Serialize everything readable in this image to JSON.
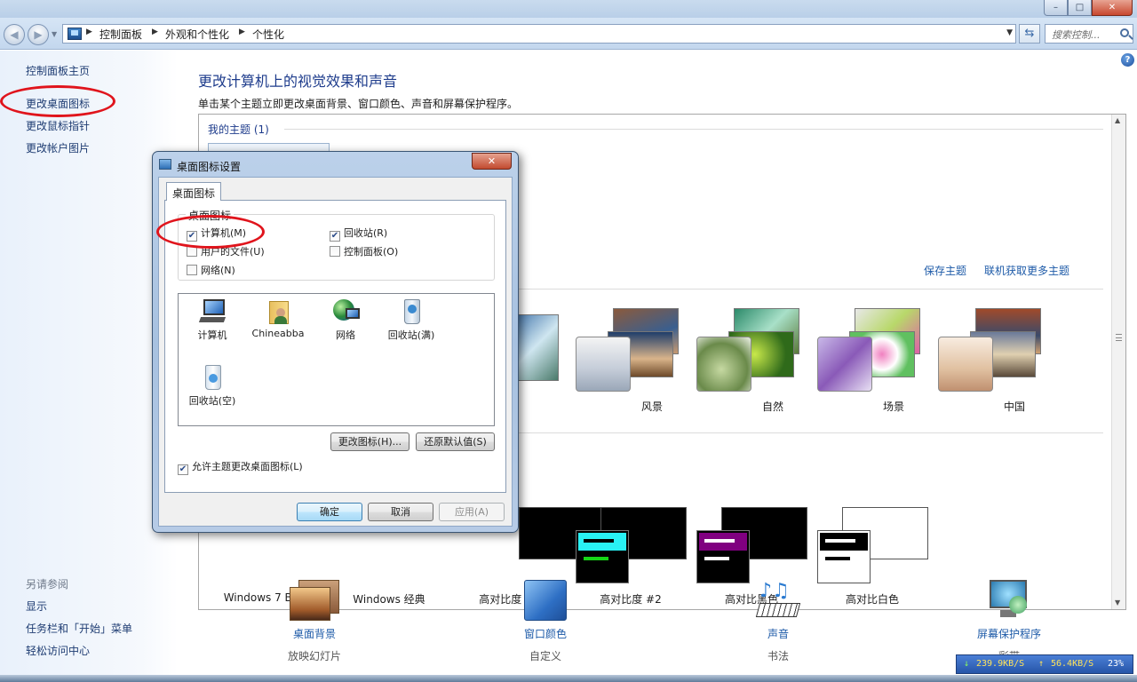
{
  "window": {
    "min": "–",
    "max": "□",
    "close": "✕"
  },
  "address": {
    "breadcrumbs": [
      "控制面板",
      "外观和个性化",
      "个性化"
    ],
    "search_placeholder": "搜索控制..."
  },
  "sidebar": {
    "home": "控制面板主页",
    "links": [
      "更改桌面图标",
      "更改鼠标指针",
      "更改帐户图片"
    ],
    "see_also_label": "另请参阅",
    "see_also": [
      "显示",
      "任务栏和「开始」菜单",
      "轻松访问中心"
    ]
  },
  "main": {
    "title": "更改计算机上的视觉效果和声音",
    "subtitle": "单击某个主题立即更改桌面背景、窗口颜色、声音和屏幕保护程序。",
    "my_themes": "我的主题 (1)",
    "save_theme": "保存主题",
    "get_more_themes": "联机获取更多主题",
    "aero_themes": [
      "风景",
      "自然",
      "场景",
      "中国"
    ],
    "basic_themes": [
      "Windows 7 Basic",
      "Windows 经典",
      "高对比度 #1",
      "高对比度 #2",
      "高对比黑色",
      "高对比白色"
    ]
  },
  "bottom": [
    {
      "label": "桌面背景",
      "sub": "放映幻灯片"
    },
    {
      "label": "窗口颜色",
      "sub": "自定义"
    },
    {
      "label": "声音",
      "sub": "书法"
    },
    {
      "label": "屏幕保护程序",
      "sub": "彩带"
    }
  ],
  "dialog": {
    "title": "桌面图标设置",
    "tab": "桌面图标",
    "group_legend": "桌面图标",
    "checkboxes": {
      "computer": {
        "label": "计算机(M)",
        "checked": true
      },
      "recycle": {
        "label": "回收站(R)",
        "checked": true
      },
      "user_files": {
        "label": "用户的文件(U)",
        "checked": false
      },
      "control_panel": {
        "label": "控制面板(O)",
        "checked": false
      },
      "network": {
        "label": "网络(N)",
        "checked": false
      }
    },
    "icons": [
      "计算机",
      "Chineabba",
      "网络",
      "回收站(满)",
      "回收站(空)"
    ],
    "change_icon": "更改图标(H)...",
    "restore_default": "还原默认值(S)",
    "allow_themes": {
      "label": "允许主题更改桌面图标(L)",
      "checked": true
    },
    "ok": "确定",
    "cancel": "取消",
    "apply": "应用(A)"
  },
  "netmeter": {
    "down": "239.9KB/S",
    "up": "56.4KB/S",
    "cpu": "23%"
  },
  "colors": {
    "link": "#1e5ba8",
    "annotation": "#e0141c"
  }
}
